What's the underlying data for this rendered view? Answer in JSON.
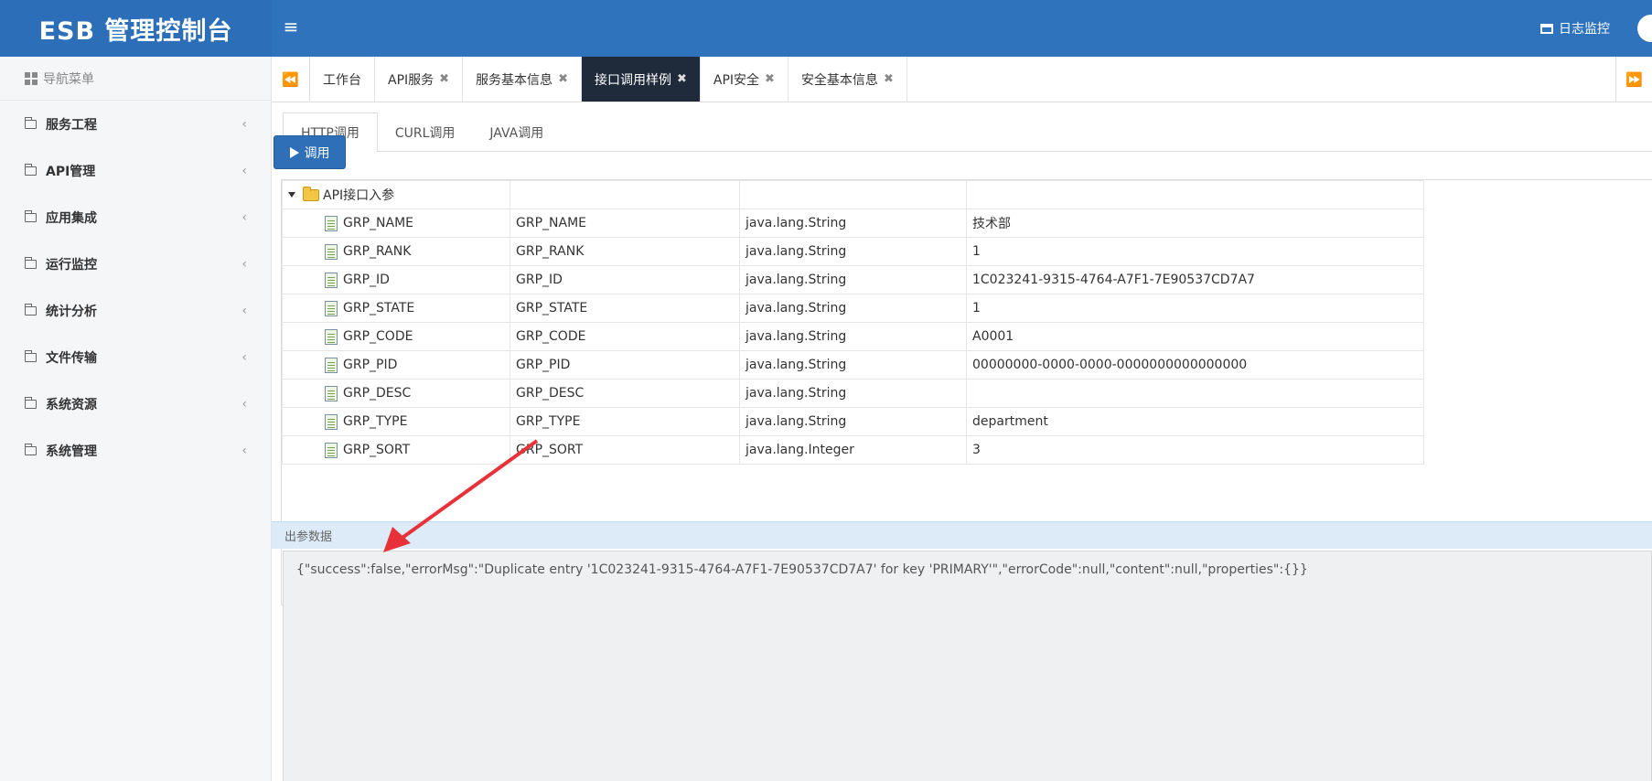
{
  "header": {
    "brand": "ESB 管理控制台",
    "menu_toggle": "≡",
    "log_monitor": "日志监控"
  },
  "sidebar": {
    "nav_title": "导航菜单",
    "items": [
      {
        "label": "服务工程"
      },
      {
        "label": "API管理"
      },
      {
        "label": "应用集成"
      },
      {
        "label": "运行监控"
      },
      {
        "label": "统计分析"
      },
      {
        "label": "文件传输"
      },
      {
        "label": "系统资源"
      },
      {
        "label": "系统管理"
      }
    ],
    "chevron": "‹"
  },
  "tabs": {
    "items": [
      {
        "label": "工作台",
        "closable": false
      },
      {
        "label": "API服务",
        "closable": true
      },
      {
        "label": "服务基本信息",
        "closable": true
      },
      {
        "label": "接口调用样例",
        "closable": true,
        "active": true
      },
      {
        "label": "API安全",
        "closable": true
      },
      {
        "label": "安全基本信息",
        "closable": true
      }
    ],
    "close_glyph": "✖"
  },
  "subtabs": [
    "HTTP调用",
    "CURL调用",
    "JAVA调用"
  ],
  "invoke_button": {
    "label": "调用"
  },
  "params": {
    "root": "API接口入参",
    "rows": [
      {
        "name": "GRP_NAME",
        "code": "GRP_NAME",
        "type": "java.lang.String",
        "value": "技术部"
      },
      {
        "name": "GRP_RANK",
        "code": "GRP_RANK",
        "type": "java.lang.String",
        "value": "1"
      },
      {
        "name": "GRP_ID",
        "code": "GRP_ID",
        "type": "java.lang.String",
        "value": "1C023241-9315-4764-A7F1-7E90537CD7A7"
      },
      {
        "name": "GRP_STATE",
        "code": "GRP_STATE",
        "type": "java.lang.String",
        "value": "1"
      },
      {
        "name": "GRP_CODE",
        "code": "GRP_CODE",
        "type": "java.lang.String",
        "value": "A0001"
      },
      {
        "name": "GRP_PID",
        "code": "GRP_PID",
        "type": "java.lang.String",
        "value": "00000000-0000-0000-0000000000000000"
      },
      {
        "name": "GRP_DESC",
        "code": "GRP_DESC",
        "type": "java.lang.String",
        "value": ""
      },
      {
        "name": "GRP_TYPE",
        "code": "GRP_TYPE",
        "type": "java.lang.String",
        "value": "department"
      },
      {
        "name": "GRP_SORT",
        "code": "GRP_SORT",
        "type": "java.lang.Integer",
        "value": "3"
      }
    ]
  },
  "output": {
    "title": "出参数据",
    "text": "{\"success\":false,\"errorMsg\":\"Duplicate entry '1C023241-9315-4764-A7F1-7E90537CD7A7' for key 'PRIMARY'\",\"errorCode\":null,\"content\":null,\"properties\":{}}"
  },
  "colors": {
    "header_bg": "#2f73bd",
    "active_tab_bg": "#1f2b3a",
    "button_bg": "#2e6fb7",
    "annotation_arrow": "#e8323a"
  }
}
